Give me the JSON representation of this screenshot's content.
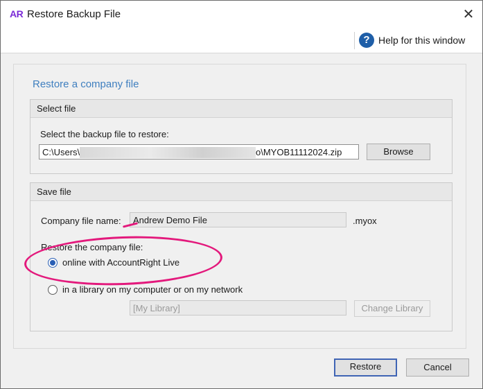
{
  "window": {
    "app_badge": "AR",
    "title": "Restore Backup File",
    "close_glyph": "✕"
  },
  "help": {
    "icon_glyph": "?",
    "label": "Help for this window"
  },
  "main": {
    "heading": "Restore a company file",
    "select_file": {
      "group_title": "Select file",
      "prompt": "Select the backup file to restore:",
      "path_prefix": "C:\\Users\\",
      "path_suffix": "o\\MYOB11112024.zip",
      "browse_label": "Browse"
    },
    "save_file": {
      "group_title": "Save file",
      "name_label": "Company file name:",
      "name_value": "Andrew Demo File",
      "extension": ".myox",
      "restore_label": "Restore the company file:",
      "option_online": "online with AccountRight Live",
      "option_online_selected": true,
      "option_library": "in a library on my computer or on my network",
      "option_library_selected": false,
      "library_value": "[My Library]",
      "change_library_label": "Change Library"
    }
  },
  "footer": {
    "restore_label": "Restore",
    "cancel_label": "Cancel"
  },
  "colors": {
    "accent": "#3f7fbf",
    "highlight": "#e3197c",
    "app_badge": "#7b2bd6"
  }
}
